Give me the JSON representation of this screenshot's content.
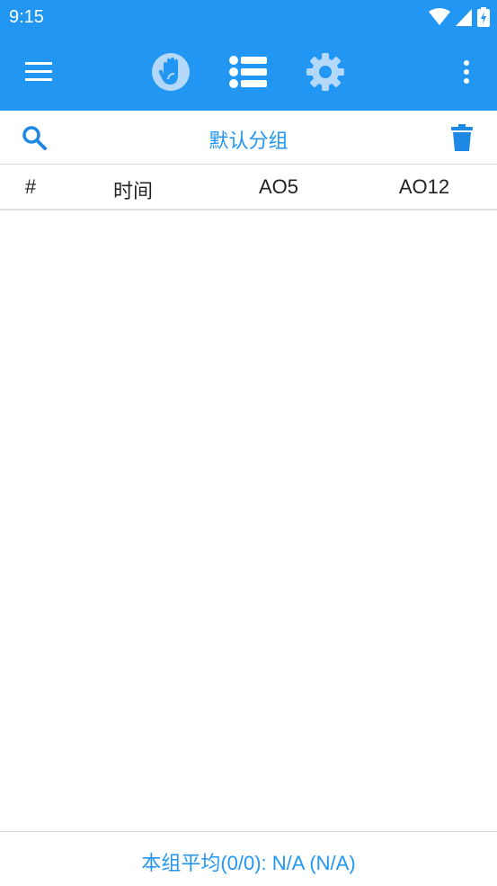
{
  "status_bar": {
    "time": "9:15"
  },
  "toolbar": {
    "icons": [
      "menu-icon",
      "hand-icon",
      "list-icon",
      "settings-gear-icon",
      "more-vert-icon"
    ],
    "background": "#2196f3"
  },
  "group": {
    "title": "默认分组"
  },
  "table": {
    "columns": [
      "#",
      "时间",
      "AO5",
      "AO12"
    ],
    "rows": []
  },
  "footer": {
    "summary": "本组平均(0/0): N/A (N/A)"
  },
  "colors": {
    "accent": "#2196f3",
    "trash": "#1e88e5"
  }
}
